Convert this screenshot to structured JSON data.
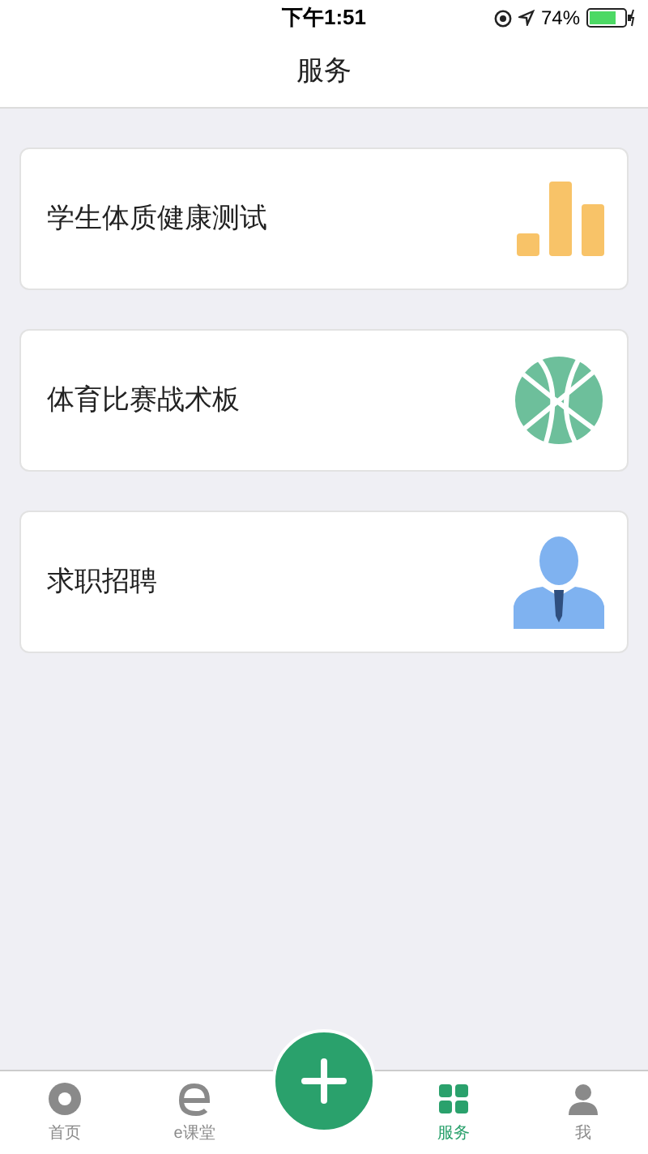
{
  "status_bar": {
    "time": "下午1:51",
    "battery": "74%"
  },
  "header": {
    "title": "服务"
  },
  "cards": [
    {
      "label": "学生体质健康测试",
      "kind": "chart"
    },
    {
      "label": "体育比赛战术板",
      "kind": "ball"
    },
    {
      "label": "求职招聘",
      "kind": "person"
    }
  ],
  "tab_bar": [
    {
      "label": "首页",
      "kind": "home",
      "selected": false
    },
    {
      "label": "e课堂",
      "kind": "e",
      "selected": false
    },
    {
      "kind": "center",
      "selected": false
    },
    {
      "label": "服务",
      "kind": "service",
      "selected": true
    },
    {
      "label": "我",
      "kind": "me",
      "selected": false
    }
  ]
}
